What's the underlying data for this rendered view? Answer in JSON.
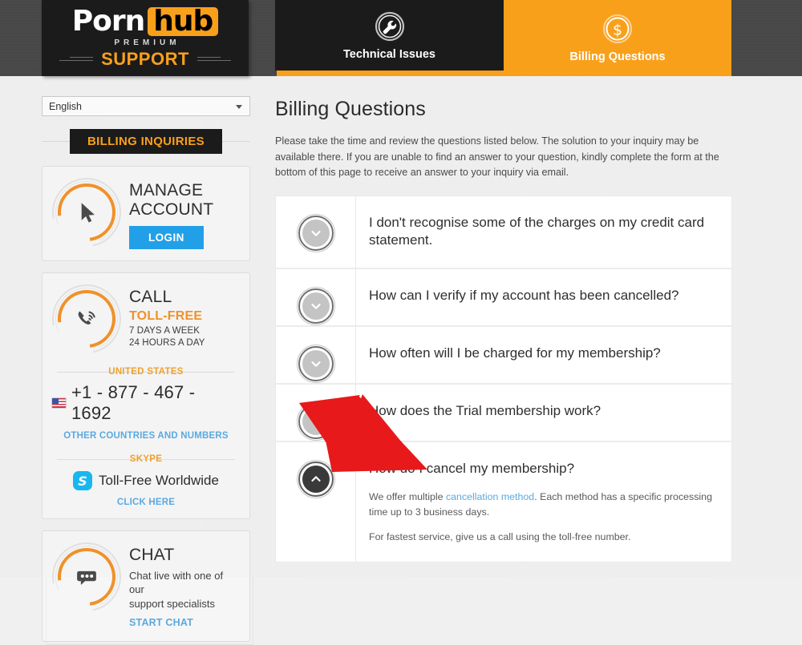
{
  "brand": {
    "name_part1": "Porn",
    "name_part2": "hub",
    "premium": "PREMIUM",
    "support": "SUPPORT",
    "accent_orange": "#f9a01b",
    "accent_blue": "#21a0e8",
    "link_blue": "#5aa9e0"
  },
  "tabs": [
    {
      "label": "Technical Issues",
      "icon": "wrench-icon",
      "active": false
    },
    {
      "label": "Billing Questions",
      "icon": "dollar-coin-icon",
      "active": true
    }
  ],
  "sidebar": {
    "language": {
      "value": "English",
      "placeholder": "English"
    },
    "section_title": "BILLING INQUIRIES",
    "manage_account": {
      "title_line1": "MANAGE",
      "title_line2": "ACCOUNT",
      "icon": "cursor-arrow-icon",
      "button": "LOGIN"
    },
    "call": {
      "title": "CALL",
      "subtitle": "TOLL-FREE",
      "hours_line1": "7 DAYS A WEEK",
      "hours_line2": "24 HOURS A DAY",
      "icon": "phone-ringing-icon",
      "country_label": "UNITED STATES",
      "phone": "+1 - 877 - 467 - 1692",
      "other_countries_link": "OTHER COUNTRIES AND NUMBERS",
      "skype_label": "SKYPE",
      "skype_text": "Toll-Free Worldwide",
      "skype_link": "CLICK HERE"
    },
    "chat": {
      "title": "CHAT",
      "icon": "chat-bubble-icon",
      "description_line1": "Chat live with one of our",
      "description_line2": "support specialists",
      "link": "START CHAT"
    }
  },
  "main": {
    "heading": "Billing Questions",
    "intro": "Please take the time and review the questions listed below. The solution to your inquiry may be available there. If you are unable to find an answer to your question, kindly complete the form at the bottom of this page to receive an answer to your inquiry via email.",
    "faq": [
      {
        "question": "I don't recognise some of the charges on my credit card statement.",
        "expanded": false
      },
      {
        "question": "How can I verify if my account has been cancelled?",
        "expanded": false
      },
      {
        "question": "How often will I be charged for my membership?",
        "expanded": false
      },
      {
        "question": "How does the Trial membership work?",
        "expanded": false
      },
      {
        "question": "How do I cancel my membership?",
        "expanded": true,
        "answer_p1_before": "We offer multiple ",
        "answer_p1_link": "cancellation method",
        "answer_p1_after": ". Each method has a specific processing time up to 3 business days.",
        "answer_p2": "For fastest service, give us a call using the toll-free number."
      }
    ]
  },
  "annotation": {
    "arrow_color": "#e8191b",
    "arrow_target": "How do I cancel my membership?"
  }
}
